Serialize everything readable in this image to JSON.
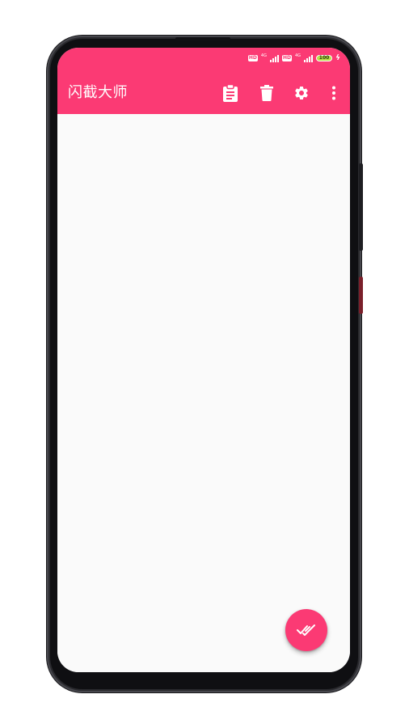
{
  "device": {
    "frame_color": "#2a2a2e"
  },
  "status_bar": {
    "sim1_badge": "HD",
    "sim1_network": "4G",
    "sim2_badge": "HD",
    "sim2_network": "4G",
    "battery_level": "100",
    "charging_symbol": "ϟ"
  },
  "appbar": {
    "title": "闪截大师",
    "background": "#fb3a74",
    "actions": [
      {
        "icon": "clipboard-icon"
      },
      {
        "icon": "delete-icon"
      },
      {
        "icon": "settings-gear-icon"
      },
      {
        "icon": "more-vertical-icon"
      }
    ]
  },
  "fab": {
    "icon": "double-check-icon",
    "color": "#fb3a74"
  }
}
